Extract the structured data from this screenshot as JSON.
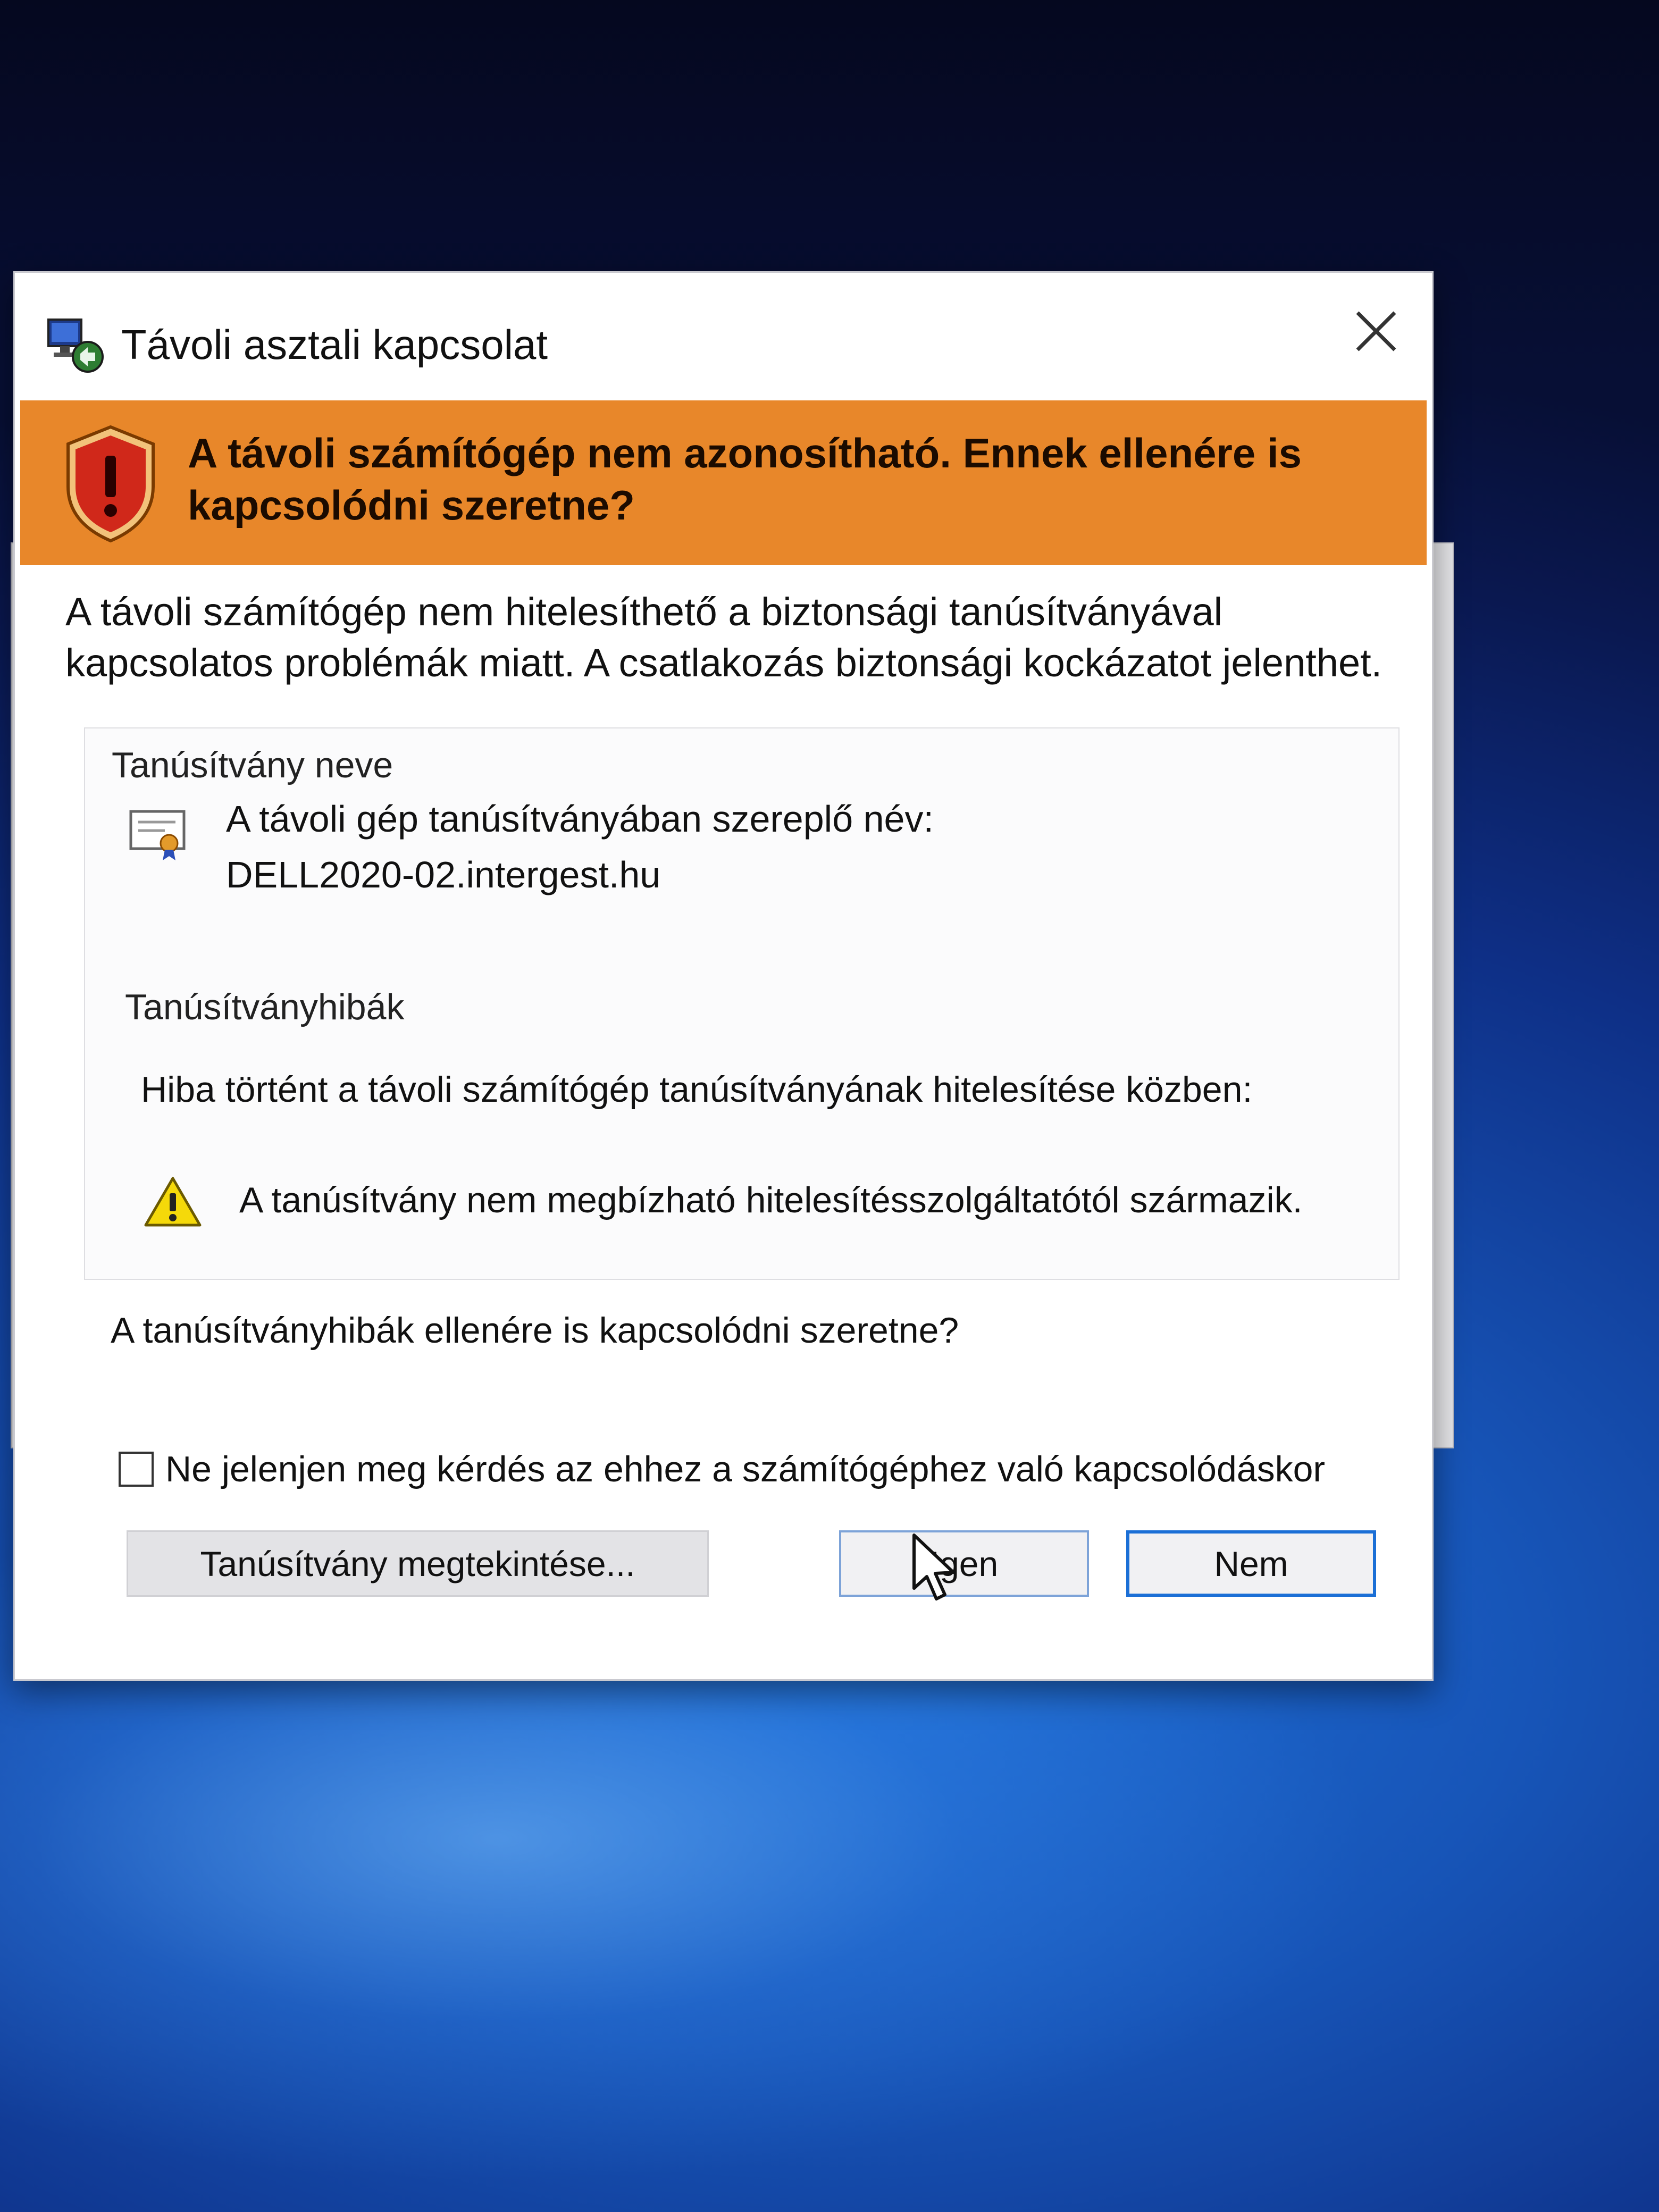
{
  "window": {
    "title": "Távoli asztali kapcsolat",
    "app_icon": "remote-desktop-icon",
    "close_icon": "close-icon"
  },
  "banner": {
    "icon": "shield-warning-icon",
    "color": "#e8872a",
    "text": "A távoli számítógép nem azonosítható. Ennek ellenére is kapcsolódni szeretne?"
  },
  "intro": {
    "text": "A távoli számítógép nem hitelesíthető a biztonsági tanúsítványával kapcsolatos problémák miatt. A csatlakozás biztonsági kockázatot jelenthet."
  },
  "certificate": {
    "section_label": "Tanúsítvány neve",
    "icon": "certificate-icon",
    "name_label": "A távoli gép tanúsítványában szereplő név:",
    "name_value": "DELL2020-02.intergest.hu"
  },
  "errors": {
    "section_label": "Tanúsítványhibák",
    "intro": "Hiba történt a távoli számítógép tanúsítványának hitelesítése közben:",
    "icon": "warning-triangle-icon",
    "item": "A tanúsítvány nem megbízható hitelesítésszolgáltatótól származik."
  },
  "question": "A tanúsítványhibák ellenére is kapcsolódni szeretne?",
  "checkbox": {
    "label": "Ne jelenjen meg kérdés az ehhez a számítógéphez való kapcsolódáskor",
    "checked": false
  },
  "buttons": {
    "view_certificate": "Tanúsítvány megtekintése...",
    "yes": "Igen",
    "no": "Nem"
  },
  "colors": {
    "banner": "#e8872a",
    "focus_border": "#1b6fd6",
    "desktop": "#1755b8"
  }
}
